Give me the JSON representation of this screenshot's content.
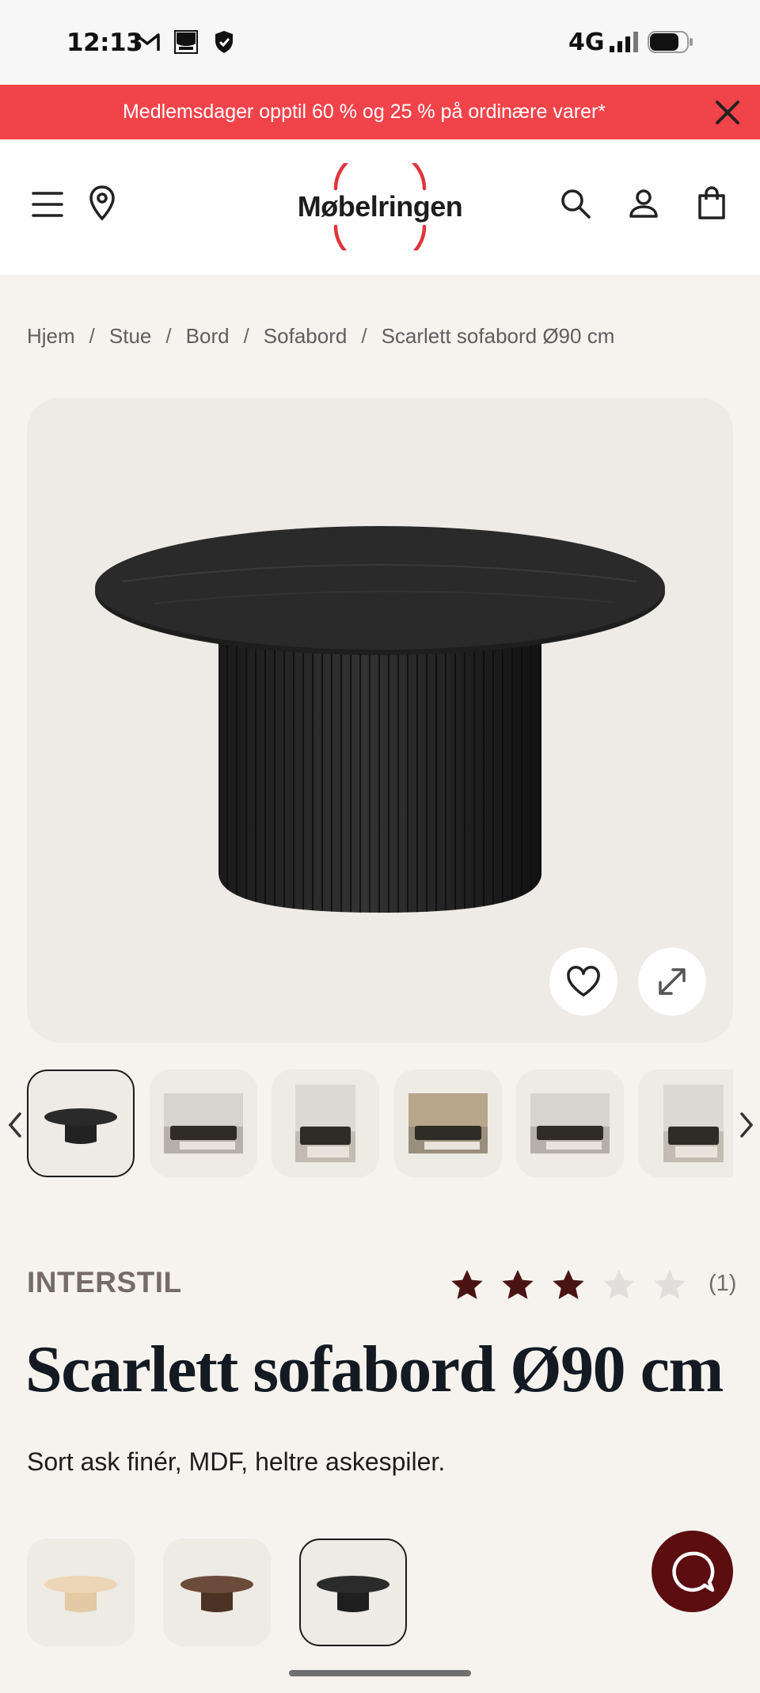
{
  "status_bar": {
    "time": "12:13",
    "network": "4G",
    "icons": [
      "gmail-icon",
      "kitchn-app-icon",
      "shield-icon",
      "signal-icon",
      "battery-icon"
    ]
  },
  "promo": {
    "text": "Medlemsdager opptil 60 % og 25 % på ordinære varer*",
    "background": "#f1434a"
  },
  "header": {
    "logo_text": "Møbelringen",
    "brand_color": "#e0353b",
    "icons": [
      "menu-icon",
      "location-pin-icon",
      "search-icon",
      "account-icon",
      "cart-icon"
    ]
  },
  "breadcrumb": {
    "items": [
      "Hjem",
      "Stue",
      "Bord",
      "Sofabord"
    ],
    "current": "Scarlett sofabord Ø90 cm",
    "separator": "/"
  },
  "product": {
    "brand": "INTERSTIL",
    "rating": 3,
    "rating_max": 5,
    "review_count": "(1)",
    "title": "Scarlett sofabord Ø90 cm",
    "description": "Sort ask finér, MDF, heltre askespiler.",
    "star_color": "#4a1414"
  },
  "gallery": {
    "thumbnail_count": 6,
    "selected_index": 0
  },
  "variants": {
    "options": [
      "natural oak",
      "walnut",
      "black ash"
    ],
    "selected_index": 2
  },
  "chat": {
    "color": "#5b0d10"
  }
}
